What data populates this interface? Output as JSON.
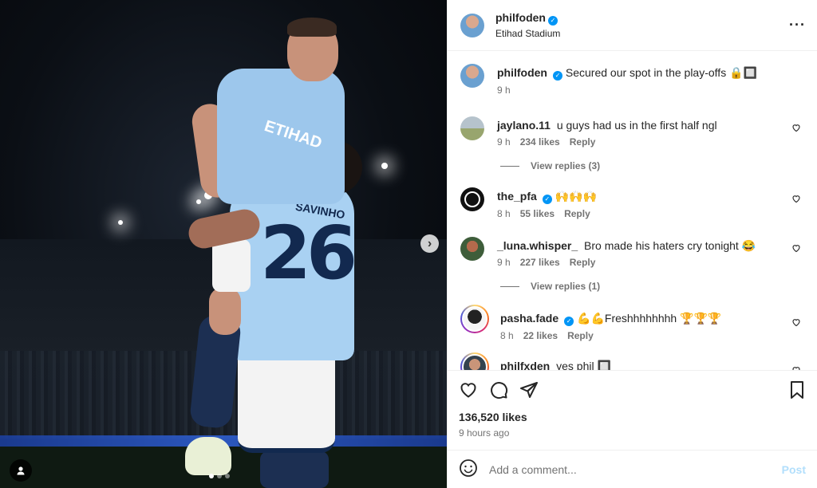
{
  "post": {
    "author": "philfoden",
    "location": "Etihad Stadium",
    "caption": "Secured our spot in the play-offs 🔒🔲",
    "caption_time": "9 h",
    "likes": "136,520 likes",
    "posted": "9 hours ago"
  },
  "photo": {
    "player_name": "SAVINHO",
    "player_number": "26",
    "sponsor": "ETIHAD"
  },
  "comments": [
    {
      "user": "jaylano.11",
      "verified": false,
      "text": "u guys had us in the first half ngl",
      "time": "9 h",
      "likes": "234 likes",
      "reply": "Reply",
      "view_replies": "View replies (3)"
    },
    {
      "user": "the_pfa",
      "verified": true,
      "text": "🙌🙌🙌",
      "time": "8 h",
      "likes": "55 likes",
      "reply": "Reply"
    },
    {
      "user": "_luna.whisper_",
      "verified": false,
      "text": "Bro made his haters cry tonight 😂",
      "time": "9 h",
      "likes": "227 likes",
      "reply": "Reply",
      "view_replies": "View replies (1)"
    },
    {
      "user": "pasha.fade",
      "verified": true,
      "text": "💪💪Freshhhhhhhh 🏆🏆🏆",
      "time": "8 h",
      "likes": "22 likes",
      "reply": "Reply"
    },
    {
      "user": "philfxden",
      "verified": false,
      "text": "yes phil 🔲"
    }
  ],
  "composer": {
    "placeholder": "Add a comment...",
    "post_label": "Post"
  },
  "colors": {
    "accent": "#0095f6",
    "post_disabled": "#b2dffc",
    "muted": "#737373"
  }
}
